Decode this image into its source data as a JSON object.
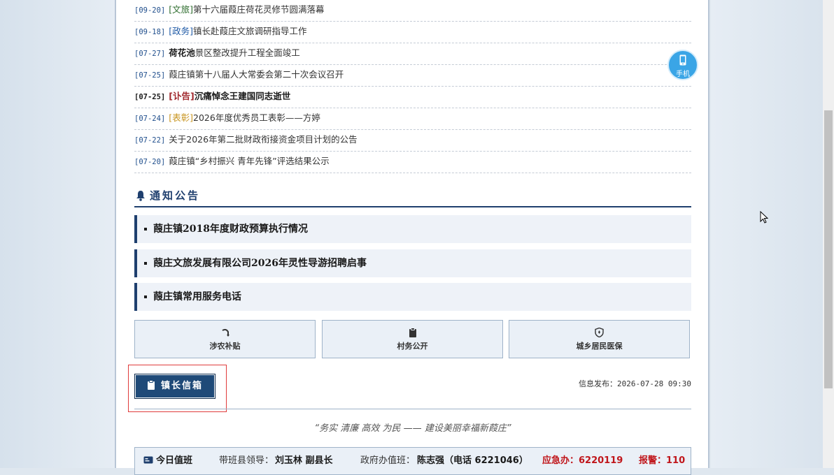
{
  "news": [
    {
      "date": "[09-20]",
      "tag": "[文旅]",
      "tag_color": "#2b6b2b",
      "title": "第十六届葭庄荷花灵修节圆满落幕",
      "style": "normal"
    },
    {
      "date": "[09-18]",
      "tag": "[政务]",
      "tag_color": "#1f5aa6",
      "title": "镇长赴葭庄文旅调研指导工作",
      "style": "normal"
    },
    {
      "date": "[07-27]",
      "tag": "荷花池",
      "tag_color": "#1a1a1a",
      "title": "景区整改提升工程全面竣工",
      "style": "highlight"
    },
    {
      "date": "[07-25]",
      "tag": "",
      "tag_color": "",
      "title": "葭庄镇第十八届人大常委会第二十次会议召开",
      "style": "normal"
    },
    {
      "date": "[07-25]",
      "tag": "[讣告]",
      "tag_color": "#a0262b",
      "title": "沉痛悼念王建国同志逝世",
      "style": "bold"
    },
    {
      "date": "[07-24]",
      "tag": "[表彰]",
      "tag_color": "#c8941e",
      "title": "2026年度优秀员工表彰——方婷",
      "style": "normal"
    },
    {
      "date": "[07-22]",
      "tag": "",
      "tag_color": "",
      "title": "关于2026年第二批财政衔接资金项目计划的公告",
      "style": "normal"
    },
    {
      "date": "[07-20]",
      "tag": "",
      "tag_color": "",
      "title": "葭庄镇“乡村振兴 青年先锋”评选结果公示",
      "style": "normal"
    }
  ],
  "notice": {
    "header": "通知公告",
    "items": [
      "葭庄镇2018年度财政预算执行情况",
      "葭庄文旅发展有限公司2026年灵性导游招聘启事",
      "葭庄镇常用服务电话"
    ]
  },
  "services": [
    {
      "label": "涉农补贴",
      "icon": "sprout-icon"
    },
    {
      "label": "村务公开",
      "icon": "clipboard-icon"
    },
    {
      "label": "城乡居民医保",
      "icon": "shield-icon"
    }
  ],
  "mayor_mailbox": {
    "label": "镇长信箱",
    "icon": "clipboard-icon"
  },
  "publish": {
    "label": "信息发布：",
    "time": "2026-07-28 09:30"
  },
  "slogan": "“务实 清廉 高效 为民 —— 建设美丽幸福新葭庄”",
  "duty": {
    "title": "今日值班",
    "leader_label": "带班县领导：",
    "leader_value": "刘玉林 副县长",
    "office_label": "政府办值班：",
    "office_value": "陈志强（电话 6221046）",
    "emergency": "应急办：6220119",
    "police": "报警：110"
  },
  "phone": {
    "label": "手机"
  },
  "colors": {
    "primary": "#1f3f6e",
    "accent_red": "#c0161b",
    "phone_blue": "#3aa5e6"
  }
}
